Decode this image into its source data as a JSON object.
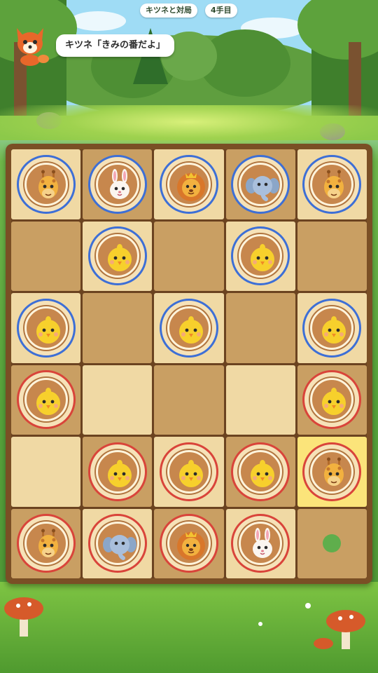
{
  "header": {
    "title": "キツネと対局",
    "move_count": "4手目"
  },
  "opponent": {
    "avatar_icon": "fox-icon",
    "speech": "キツネ「きみの番だよ」"
  },
  "colors": {
    "blue_player": "#3d6fd6",
    "red_player": "#d9443a",
    "highlight": "#fbe47a",
    "move_hint": "#5fae4c"
  },
  "board": {
    "columns": 5,
    "rows": 6,
    "cells": [
      [
        {
          "piece": "giraffe",
          "side": "blue"
        },
        {
          "piece": "rabbit",
          "side": "blue"
        },
        {
          "piece": "lion",
          "side": "blue"
        },
        {
          "piece": "elephant",
          "side": "blue"
        },
        {
          "piece": "giraffe",
          "side": "blue"
        }
      ],
      [
        null,
        {
          "piece": "chick",
          "side": "blue"
        },
        null,
        {
          "piece": "chick",
          "side": "blue"
        },
        null
      ],
      [
        {
          "piece": "chick",
          "side": "blue"
        },
        null,
        {
          "piece": "chick",
          "side": "blue"
        },
        null,
        {
          "piece": "chick",
          "side": "blue"
        }
      ],
      [
        {
          "piece": "chick",
          "side": "red"
        },
        null,
        null,
        null,
        {
          "piece": "chick",
          "side": "red"
        }
      ],
      [
        null,
        {
          "piece": "chick",
          "side": "red"
        },
        {
          "piece": "chick",
          "side": "red"
        },
        {
          "piece": "chick",
          "side": "red"
        },
        {
          "piece": "giraffe",
          "side": "red",
          "selected": true
        }
      ],
      [
        {
          "piece": "giraffe",
          "side": "red"
        },
        {
          "piece": "elephant",
          "side": "red"
        },
        {
          "piece": "lion",
          "side": "red"
        },
        {
          "piece": "rabbit",
          "side": "red"
        },
        {
          "move_hint": true
        }
      ]
    ]
  }
}
